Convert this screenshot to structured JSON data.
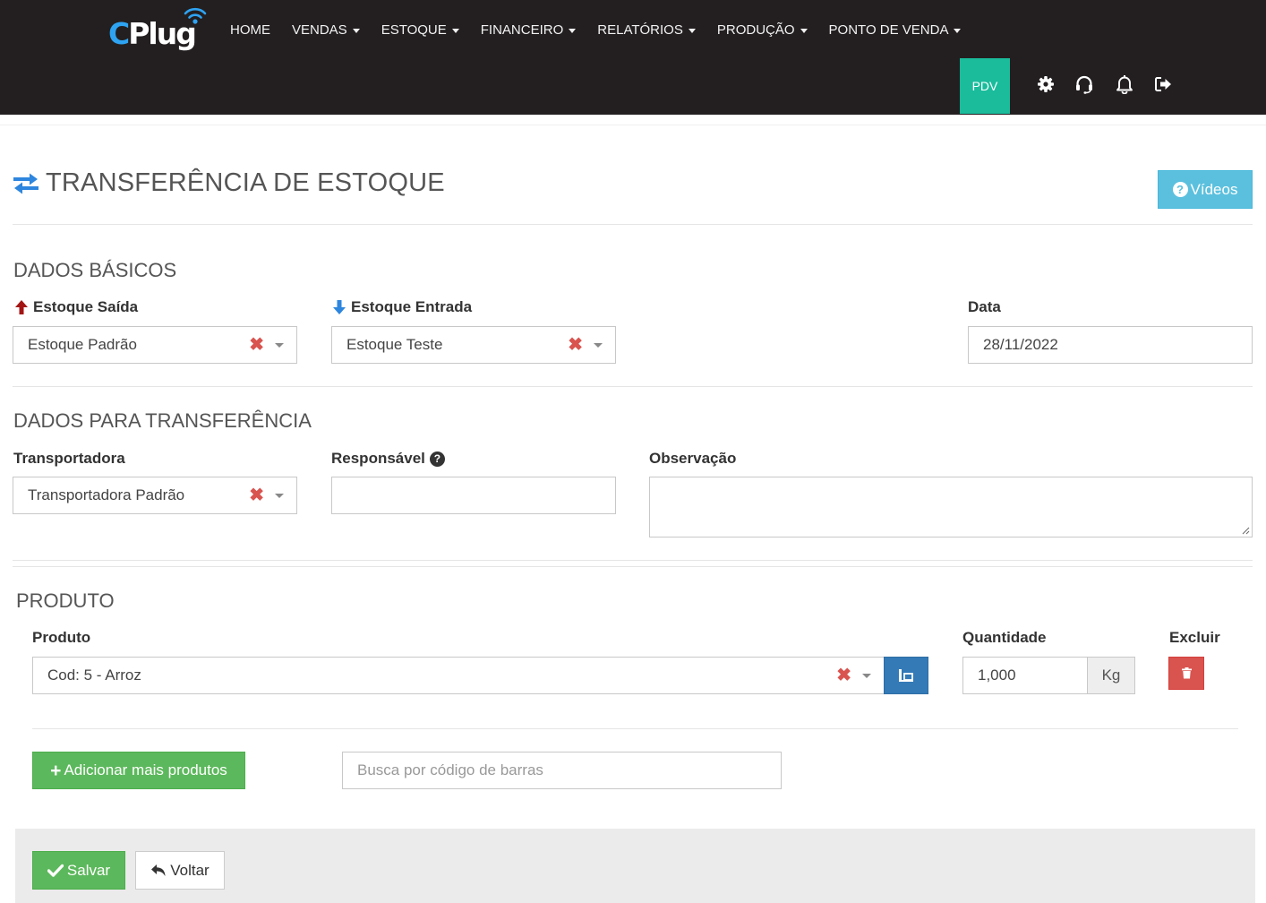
{
  "brand": {
    "logo_prefix": "C",
    "logo_rest": "Plug"
  },
  "nav": {
    "items": [
      {
        "label": "HOME",
        "dropdown": false
      },
      {
        "label": "VENDAS",
        "dropdown": true
      },
      {
        "label": "ESTOQUE",
        "dropdown": true
      },
      {
        "label": "FINANCEIRO",
        "dropdown": true
      },
      {
        "label": "RELATÓRIOS",
        "dropdown": true
      },
      {
        "label": "PRODUÇÃO",
        "dropdown": true
      },
      {
        "label": "PONTO DE VENDA",
        "dropdown": true
      }
    ],
    "pdv_label": "PDV",
    "icons": [
      "gear-icon",
      "headset-icon",
      "bell-icon",
      "logout-icon"
    ]
  },
  "page": {
    "title": "TRANSFERÊNCIA DE ESTOQUE",
    "videos_label": "Vídeos"
  },
  "basic": {
    "section_title": "DADOS BÁSICOS",
    "estoque_saida_label": "Estoque Saída",
    "estoque_saida_value": "Estoque Padrão",
    "estoque_entrada_label": "Estoque Entrada",
    "estoque_entrada_value": "Estoque Teste",
    "data_label": "Data",
    "data_value": "28/11/2022"
  },
  "transfer": {
    "section_title": "DADOS PARA TRANSFERÊNCIA",
    "transportadora_label": "Transportadora",
    "transportadora_value": "Transportadora Padrão",
    "responsavel_label": "Responsável",
    "responsavel_value": "",
    "observacao_label": "Observação",
    "observacao_value": ""
  },
  "product": {
    "section_title": "PRODUTO",
    "produto_label": "Produto",
    "produto_value": "Cod: 5 - Arroz",
    "quantidade_label": "Quantidade",
    "quantidade_value": "1,000",
    "unit": "Kg",
    "excluir_label": "Excluir",
    "add_button_label": "Adicionar mais produtos",
    "barcode_placeholder": "Busca por código de barras"
  },
  "footer": {
    "save_label": "Salvar",
    "back_label": "Voltar"
  },
  "colors": {
    "navbar_bg": "#231f20",
    "pdv_bg": "#1abc9c",
    "info": "#5bc0de",
    "primary": "#337ab7",
    "success": "#5cb85c",
    "danger": "#d9534f",
    "arrow_up": "#a31515",
    "arrow_down": "#2e86de"
  }
}
